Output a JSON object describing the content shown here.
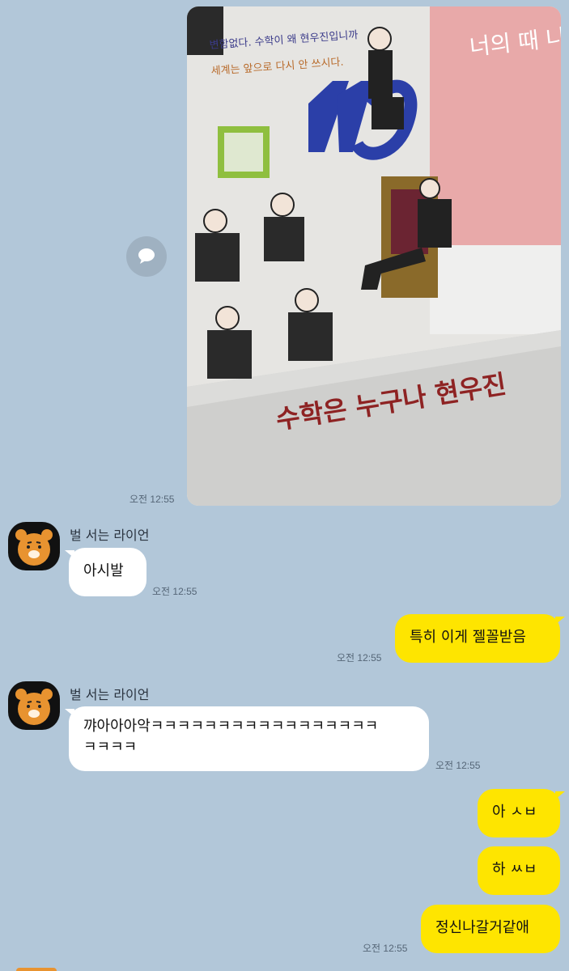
{
  "colors": {
    "background": "#b2c7d9",
    "sent_bubble": "#fee500",
    "received_bubble": "#ffffff",
    "timestamp": "#556677"
  },
  "photo_message": {
    "book_text": "수학은 누구나 현우진",
    "handwriting_line1": "변함없다. 수학이 왜 현우진입니까",
    "handwriting_line2": "세계는 앞으로 다시 안 쓰시다.",
    "pink_book_text": "너의 때 나의",
    "time": "오전 12:55",
    "share_icon": "speech-bubble-icon"
  },
  "messages": [
    {
      "id": "m1",
      "direction": "in",
      "sender": "벌 서는 라이언",
      "text": "아시발",
      "time": "오전 12:55"
    },
    {
      "id": "m2",
      "direction": "out",
      "text": "특히 이게 젤꼴받음",
      "time": "오전 12:55"
    },
    {
      "id": "m3",
      "direction": "in",
      "sender": "벌 서는 라이언",
      "text_line1": "꺄아아아악ㅋㅋㅋㅋㅋㅋㅋㅋㅋㅋㅋㅋㅋㅋㅋㅋㅋ",
      "text_line2": "ㅋㅋㅋㅋ",
      "time": "오전 12:55"
    },
    {
      "id": "m4",
      "direction": "out",
      "text": "아 ㅅㅂ"
    },
    {
      "id": "m5",
      "direction": "out",
      "text": "하 ㅆㅂ"
    },
    {
      "id": "m6",
      "direction": "out",
      "text": "정신나갈거같애",
      "time": "오전 12:55"
    }
  ]
}
